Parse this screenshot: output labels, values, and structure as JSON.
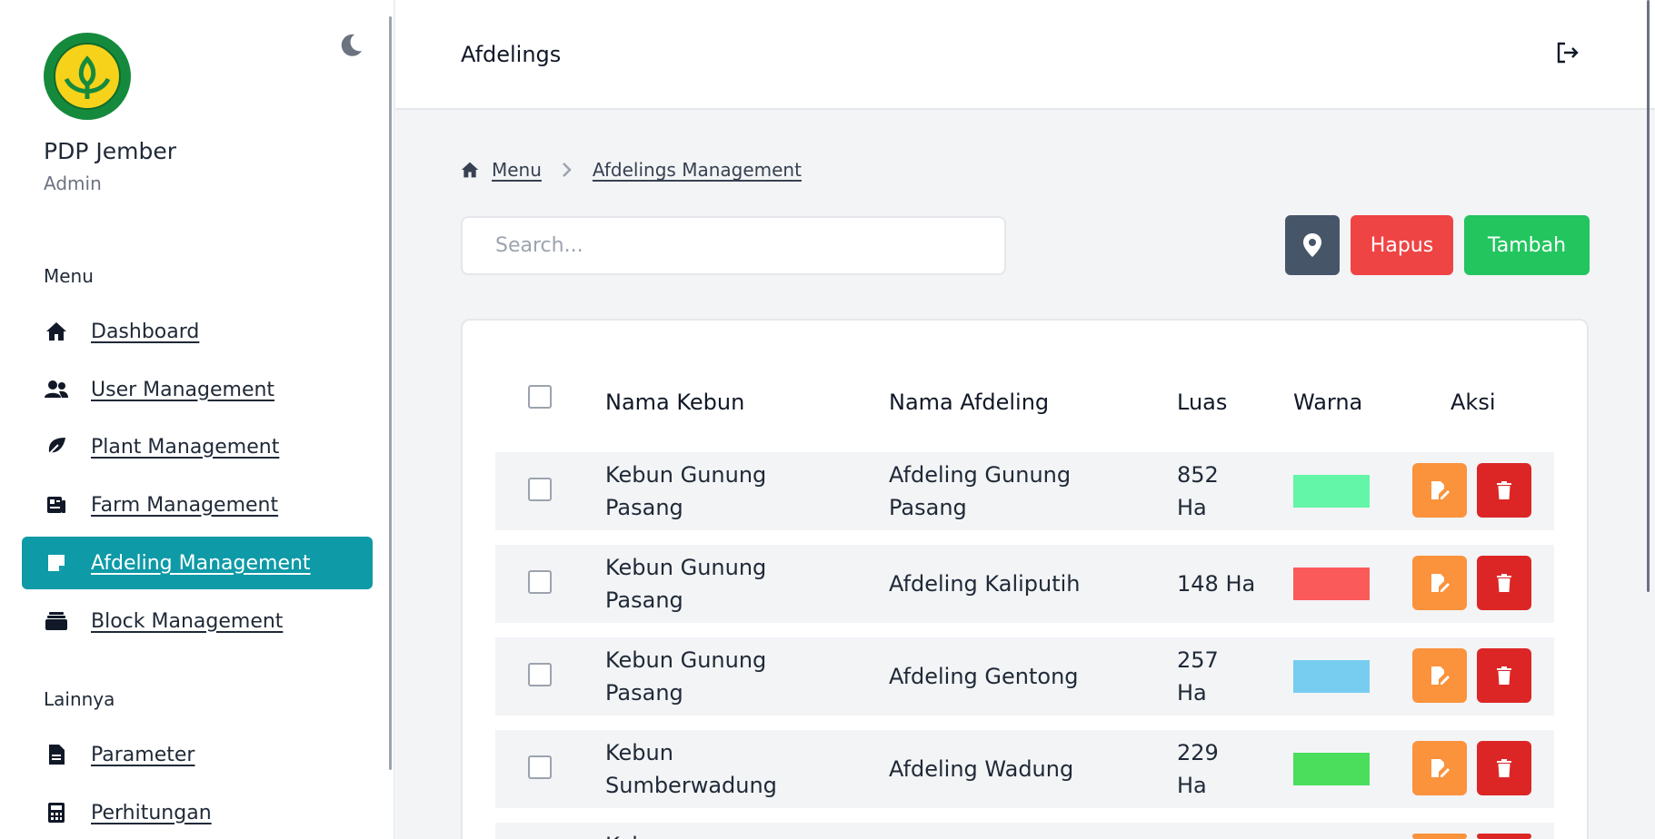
{
  "sidebar": {
    "brand": "PDP Jember",
    "role": "Admin",
    "menu_label": "Menu",
    "menu_items": [
      {
        "label": "Dashboard",
        "icon": "home-icon"
      },
      {
        "label": "User Management",
        "icon": "users-icon"
      },
      {
        "label": "Plant Management",
        "icon": "leaf-icon"
      },
      {
        "label": "Farm Management",
        "icon": "newspaper-icon"
      },
      {
        "label": "Afdeling Management",
        "icon": "note-icon",
        "active": true
      },
      {
        "label": "Block Management",
        "icon": "layers-icon"
      }
    ],
    "other_label": "Lainnya",
    "other_items": [
      {
        "label": "Parameter",
        "icon": "document-icon"
      },
      {
        "label": "Perhitungan",
        "icon": "calculator-icon"
      }
    ]
  },
  "header": {
    "title": "Afdelings"
  },
  "breadcrumb": {
    "items": [
      "Menu",
      "Afdelings Management"
    ]
  },
  "search": {
    "placeholder": "Search..."
  },
  "toolbar": {
    "hapus_label": "Hapus",
    "tambah_label": "Tambah"
  },
  "table": {
    "columns": [
      "Nama Kebun",
      "Nama Afdeling",
      "Luas",
      "Warna",
      "Aksi"
    ],
    "rows": [
      {
        "kebun": [
          "Kebun Gunung",
          "Pasang"
        ],
        "afdeling": [
          "Afdeling Gunung",
          "Pasang"
        ],
        "luas": [
          "852",
          "Ha"
        ],
        "warna": "#63f5a8"
      },
      {
        "kebun": [
          "Kebun Gunung",
          "Pasang"
        ],
        "afdeling": [
          "Afdeling Kaliputih"
        ],
        "luas": [
          "148 Ha"
        ],
        "warna": "#fb5a5a"
      },
      {
        "kebun": [
          "Kebun Gunung",
          "Pasang"
        ],
        "afdeling": [
          "Afdeling Gentong"
        ],
        "luas": [
          "257",
          "Ha"
        ],
        "warna": "#76cdf0"
      },
      {
        "kebun": [
          "Kebun",
          "Sumberwadung"
        ],
        "afdeling": [
          "Afdeling Wadung"
        ],
        "luas": [
          "229",
          "Ha"
        ],
        "warna": "#4ade5c"
      },
      {
        "kebun": [
          "Kebun"
        ],
        "afdeling": [
          ""
        ],
        "luas": [
          ""
        ],
        "warna": "#f3f4f6"
      }
    ]
  },
  "colors": {
    "accent": "#0e9aa7",
    "danger": "#ef4444",
    "success": "#22c55e",
    "edit": "#fb923c",
    "slate": "#475569"
  }
}
